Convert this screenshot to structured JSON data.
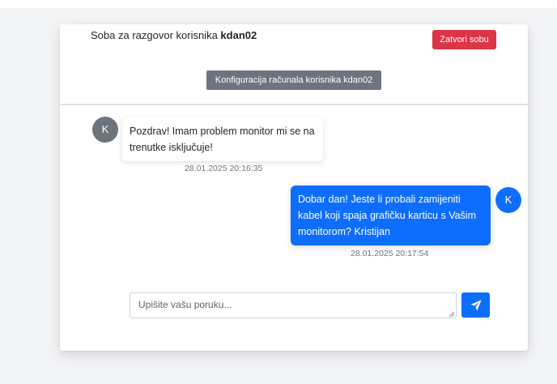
{
  "header": {
    "title_prefix": "Soba za razgovor korisnika",
    "username": "kdan02",
    "close_label": "Zatvori sobu",
    "config_label": "Konfiguracija računala korisnika kdan02"
  },
  "messages": [
    {
      "direction": "incoming",
      "avatar": "K",
      "text": "Pozdrav! Imam problem monitor mi se na trenutke isključuje!",
      "timestamp": "28.01.2025 20:16:35"
    },
    {
      "direction": "outgoing",
      "avatar": "K",
      "text": "Dobar dan! Jeste li probali zamijeniti kabel koji spaja grafičku karticu s Vašim monitorom? Kristijan",
      "timestamp": "28.01.2025 20:17:54"
    }
  ],
  "composer": {
    "placeholder": "Upišite vašu poruku...",
    "value": "",
    "send_icon": "paper-plane-icon"
  },
  "colors": {
    "primary": "#0d6efd",
    "danger": "#dc3545",
    "secondary": "#6c757d"
  }
}
